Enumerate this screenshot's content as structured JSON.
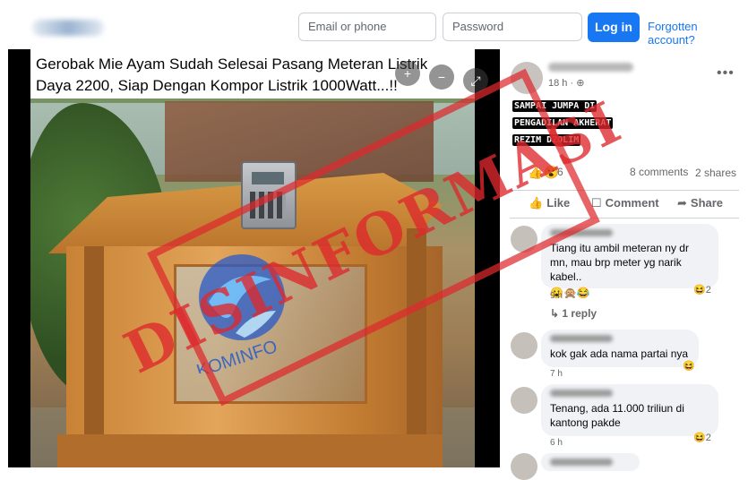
{
  "header": {
    "email_placeholder": "Email or phone",
    "password_placeholder": "Password",
    "login_label": "Log in",
    "forgot_label": "Forgotten account?"
  },
  "photo": {
    "caption": "Gerobak Mie Ayam Sudah Selesai Pasang Meteran Listrik Daya 2200, Siap Dengan Kompor Listrik 1000Watt...!!",
    "watermark": "KOMINFO"
  },
  "stamp": {
    "text": "DISINFORMASI",
    "color": "#de282c"
  },
  "post": {
    "time": "18 h · ",
    "lines": [
      "SAMPAI JUMPA DI",
      "PENGADILAN AKHERAT",
      "REZIM DZOLIM"
    ],
    "reaction_count": "6",
    "comments": "8 comments",
    "shares": "2 shares",
    "actions": {
      "like": "Like",
      "comment": "Comment",
      "share": "Share"
    }
  },
  "comments": [
    {
      "text": "Tiang itu ambil meteran ny dr mn, mau brp meter yg narik kabel..",
      "time": "9 h",
      "reactions": "2"
    },
    {
      "text": "kok gak ada nama partai nya",
      "time": "7 h",
      "reactions": ""
    },
    {
      "text": "Tenang, ada 11.000 triliun di kantong pakde",
      "time": "6 h",
      "reactions": "2"
    }
  ],
  "reply": {
    "label": "↳ 1 reply"
  },
  "colors": {
    "accent": "#1877f2",
    "stamp": "#de282c"
  }
}
